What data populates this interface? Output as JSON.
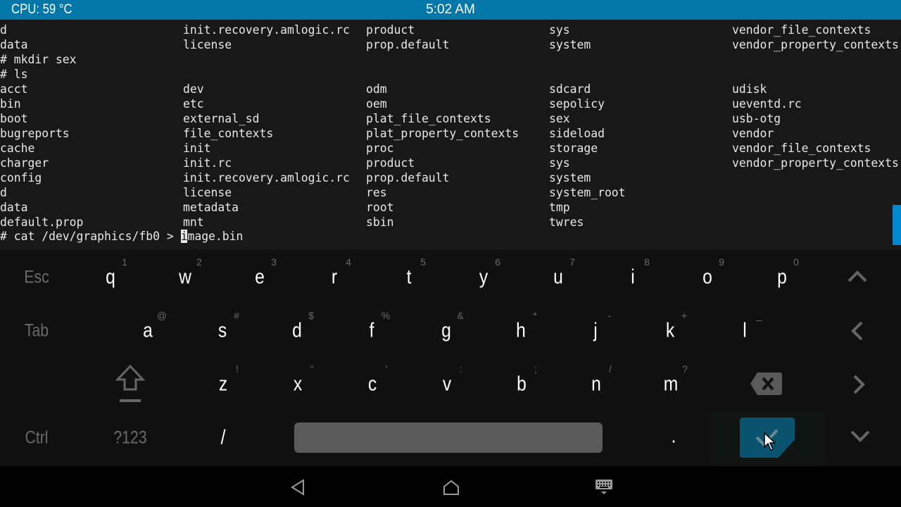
{
  "status_bar": {
    "cpu": "CPU: 59 °C",
    "time": "5:02 AM"
  },
  "terminal": {
    "lines": [
      [
        "d",
        "init.recovery.amlogic.rc",
        "product",
        "sys",
        "vendor_file_contexts"
      ],
      [
        "data",
        "license",
        "prop.default",
        "system",
        "vendor_property_contexts"
      ],
      [
        "# mkdir sex",
        "",
        "",
        "",
        ""
      ],
      [
        "# ls",
        "",
        "",
        "",
        ""
      ],
      [
        "acct",
        "dev",
        "odm",
        "sdcard",
        "udisk"
      ],
      [
        "bin",
        "etc",
        "oem",
        "sepolicy",
        "ueventd.rc"
      ],
      [
        "boot",
        "external_sd",
        "plat_file_contexts",
        "sex",
        "usb-otg"
      ],
      [
        "bugreports",
        "file_contexts",
        "plat_property_contexts",
        "sideload",
        "vendor"
      ],
      [
        "cache",
        "init",
        "proc",
        "storage",
        "vendor_file_contexts"
      ],
      [
        "charger",
        "init.rc",
        "product",
        "sys",
        "vendor_property_contexts"
      ],
      [
        "config",
        "init.recovery.amlogic.rc",
        "prop.default",
        "system",
        ""
      ],
      [
        "d",
        "license",
        "res",
        "system_root",
        ""
      ],
      [
        "data",
        "metadata",
        "root",
        "tmp",
        ""
      ],
      [
        "default.prop",
        "mnt",
        "sbin",
        "twres",
        ""
      ]
    ],
    "command_prefix": "# cat /dev/graphics/fb0 > ",
    "command_cursor_char": "i",
    "command_rest": "mage.bin"
  },
  "keyboard": {
    "row1": {
      "keys": [
        "q",
        "w",
        "e",
        "r",
        "t",
        "y",
        "u",
        "i",
        "o",
        "p"
      ],
      "hints": [
        "1",
        "2",
        "3",
        "4",
        "5",
        "6",
        "7",
        "8",
        "9",
        "0"
      ]
    },
    "row2": {
      "keys": [
        "a",
        "s",
        "d",
        "f",
        "g",
        "h",
        "j",
        "k",
        "l"
      ],
      "hints": [
        "@",
        "#",
        "$",
        "%",
        "&",
        "*",
        "-",
        "+",
        "_"
      ]
    },
    "row3": {
      "keys": [
        "z",
        "x",
        "c",
        "v",
        "b",
        "n",
        "m"
      ],
      "hints": [
        "!",
        "\"",
        "'",
        ":",
        ";",
        "/",
        "?"
      ]
    },
    "esc": "Esc",
    "tab": "Tab",
    "ctrl": "Ctrl",
    "sym": "?123",
    "slash": "/",
    "period": "."
  },
  "colors": {
    "status_bar": "#0277a8",
    "enter": "#0a5470",
    "scrollbar": "#0288d1"
  }
}
